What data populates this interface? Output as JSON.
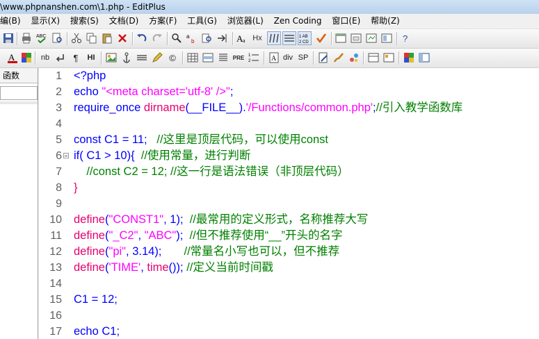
{
  "window": {
    "title": "\\www.phpnanshen.com\\1.php - EditPlus"
  },
  "menu": [
    {
      "label": "编(B)"
    },
    {
      "label": "显示(X)"
    },
    {
      "label": "搜索(S)"
    },
    {
      "label": "文档(D)"
    },
    {
      "label": "方案(F)"
    },
    {
      "label": "工具(G)"
    },
    {
      "label": "浏览器(L)"
    },
    {
      "label": "Zen Coding"
    },
    {
      "label": "窗口(E)"
    },
    {
      "label": "帮助(Z)"
    }
  ],
  "toolbar2_text": {
    "nb": "nb",
    "hi": "HI",
    "pre": "PRE",
    "div": "div",
    "sp": "SP",
    "hx": "Hx"
  },
  "sidebar": {
    "tab_label": "函数"
  },
  "editor": {
    "line_numbers": [
      "1",
      "2",
      "3",
      "4",
      "5",
      "6",
      "7",
      "8",
      "9",
      "10",
      "11",
      "12",
      "13",
      "14",
      "15",
      "16",
      "17"
    ],
    "lines": [
      [
        {
          "t": "<?php",
          "c": "k"
        }
      ],
      [
        {
          "t": "echo ",
          "c": "k"
        },
        {
          "t": "\"<meta charset='utf-8' />\"",
          "c": "s"
        },
        {
          "t": ";",
          "c": "k"
        }
      ],
      [
        {
          "t": "require_once ",
          "c": "k"
        },
        {
          "t": "dirname",
          "c": "f"
        },
        {
          "t": "(__FILE__).",
          "c": "k"
        },
        {
          "t": "'/Functions/common.php'",
          "c": "s"
        },
        {
          "t": ";",
          "c": "k"
        },
        {
          "t": "//引入教学函数库",
          "c": "c"
        }
      ],
      [],
      [
        {
          "t": "const C1 = 11;   ",
          "c": "k"
        },
        {
          "t": "//这里是顶层代码，可以使用const",
          "c": "c"
        }
      ],
      [
        {
          "t": "if( C1 > 10){  ",
          "c": "k"
        },
        {
          "t": "//使用常量，进行判断",
          "c": "c"
        }
      ],
      [
        {
          "t": "    //const C2 = 12; //这一行是语法错误（非顶层代码）",
          "c": "c"
        }
      ],
      [
        {
          "t": "}",
          "c": "f"
        }
      ],
      [],
      [
        {
          "t": "define",
          "c": "f"
        },
        {
          "t": "(",
          "c": "k"
        },
        {
          "t": "\"CONST1\"",
          "c": "s"
        },
        {
          "t": ", 1);  ",
          "c": "k"
        },
        {
          "t": "//最常用的定义形式，名称推荐大写",
          "c": "c"
        }
      ],
      [
        {
          "t": "define",
          "c": "f"
        },
        {
          "t": "(",
          "c": "k"
        },
        {
          "t": "\"_C2\"",
          "c": "s"
        },
        {
          "t": ", ",
          "c": "k"
        },
        {
          "t": "\"ABC\"",
          "c": "s"
        },
        {
          "t": ");  ",
          "c": "k"
        },
        {
          "t": "//但不推荐使用“__”开头的名字",
          "c": "c"
        }
      ],
      [
        {
          "t": "define",
          "c": "f"
        },
        {
          "t": "(",
          "c": "k"
        },
        {
          "t": "\"pi\"",
          "c": "s"
        },
        {
          "t": ", 3.14);       ",
          "c": "k"
        },
        {
          "t": "//常量名小写也可以，但不推荐",
          "c": "c"
        }
      ],
      [
        {
          "t": "define",
          "c": "f"
        },
        {
          "t": "(",
          "c": "k"
        },
        {
          "t": "'TIME'",
          "c": "s"
        },
        {
          "t": ", ",
          "c": "k"
        },
        {
          "t": "time",
          "c": "f"
        },
        {
          "t": "()); ",
          "c": "k"
        },
        {
          "t": "//定义当前时间戳",
          "c": "c"
        }
      ],
      [],
      [
        {
          "t": "C1 = 12;",
          "c": "k"
        }
      ],
      [],
      [
        {
          "t": "echo C1;",
          "c": "k"
        }
      ]
    ]
  }
}
